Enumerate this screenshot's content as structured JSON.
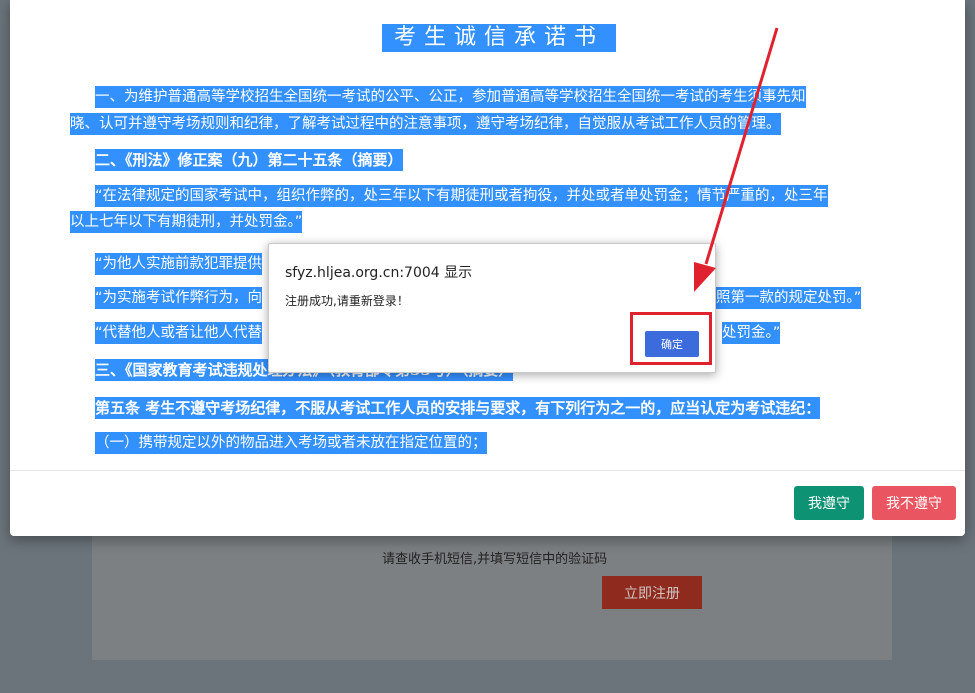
{
  "background_page": {
    "hint": "请查收手机短信,并填写短信中的验证码",
    "register_button": "立即注册"
  },
  "modal": {
    "title": "考生诚信承诺书",
    "paragraphs": {
      "p1_l1": "一、为维护普通高等学校招生全国统一考试的公平、公正，参加普通高等学校招生全国统一考试的考生须事先知",
      "p1_l2": "晓、认可并遵守考场规则和纪律，了解考试过程中的注意事项，遵守考场纪律，自觉服从考试工作人员的管理。",
      "h2": "二、《刑法》修正案（九）第二十五条（摘要）",
      "p2_l1": "“在法律规定的国家考试中，组织作弊的，处三年以下有期徒刑或者拘役，并处或者单处罚金；情节严重的，处三年",
      "p2_l2": "以上七年以下有期徒刑，并处罚金。”",
      "p3_start": "“为他人实施前款犯罪提供",
      "p4_start": "“为实施考试作弊行为，向",
      "p4_end": "照第一款的规定处罚。”",
      "p5_start": "“代替他人或者让他人代替",
      "p5_end": "处罚金。”",
      "h3": "三、《国家教育考试违规处理办法》（教育部令第33号）（摘要）",
      "h4": "第五条 考生不遵守考场纪律，不服从考试工作人员的安排与要求，有下列行为之一的，应当认定为考试违纪：",
      "item1": "（一）携带规定以外的物品进入考场或者未放在指定位置的；"
    },
    "agree_button": "我遵守",
    "disagree_button": "我不遵守"
  },
  "alert": {
    "title": "sfyz.hljea.org.cn:7004 显示",
    "message": "注册成功,请重新登录！",
    "ok_button": "确定"
  },
  "colors": {
    "selection": "#3390ff",
    "agree": "#0e9274",
    "disagree": "#e95561",
    "annotation": "#e0212e",
    "ok": "#3c6bdc"
  }
}
